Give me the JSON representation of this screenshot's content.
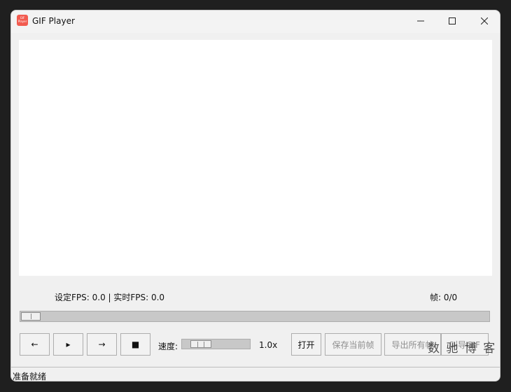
{
  "window": {
    "title": "GIF Player",
    "app_icon_text": "GIF Player"
  },
  "info": {
    "fps_text": "设定FPS: 0.0 | 实时FPS: 0.0",
    "frame_text": "帧: 0/0"
  },
  "progress": {
    "value": 0
  },
  "controls": {
    "prev_label": "←",
    "play_label": "▸",
    "next_label": "→",
    "stop_label": "■",
    "speed_label": "速度:",
    "speed_value": "1.0x",
    "open_label": "打开",
    "save_frame_label": "保存当前帧",
    "export_all_label": "导出所有帧",
    "gif_label": "叫导GIF"
  },
  "watermark": "数 驰 博 客",
  "status": {
    "text": "准备就绪"
  }
}
